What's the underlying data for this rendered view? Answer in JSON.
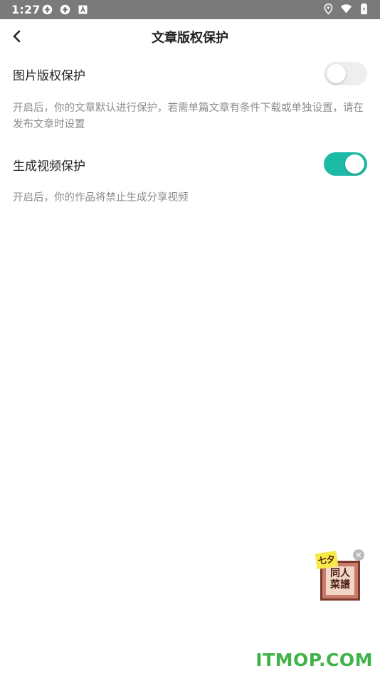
{
  "status_bar": {
    "time": "1:27",
    "icons_left": [
      "sync-icon",
      "sync-icon",
      "font-icon"
    ],
    "icons_right": [
      "location-icon",
      "wifi-icon",
      "battery-icon"
    ]
  },
  "header": {
    "back_icon": "chevron-left-icon",
    "title": "文章版权保护"
  },
  "settings": [
    {
      "label": "图片版权保护",
      "enabled": false,
      "description": "开启后，你的文章默认进行保护，若需单篇文章有条件下载或单独设置，请在发布文章时设置"
    },
    {
      "label": "生成视频保护",
      "enabled": true,
      "description": "开启后，你的作品将禁止生成分享视频"
    }
  ],
  "colors": {
    "accent": "#1dbba6",
    "toggle_off": "#eeeeee",
    "status_bar": "#7a7a7a",
    "desc_text": "#8c8c8c",
    "watermark": "#3fb34a"
  },
  "float_ad": {
    "sticky_text": "七夕",
    "line1": "同人",
    "line2": "菜譜",
    "close_icon": "close-icon"
  },
  "watermark": "ITMOP.COM"
}
